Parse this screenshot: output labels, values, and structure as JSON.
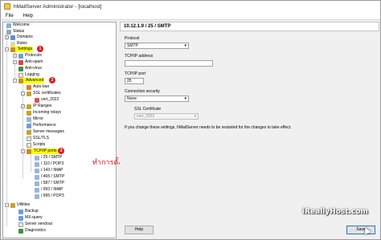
{
  "window": {
    "title": "hMailServer Administrator - [localhost]"
  },
  "menu": [
    "File",
    "Help"
  ],
  "tree": {
    "welcome": "Welcome",
    "status": "Status",
    "domains": "Domains",
    "rules": "Rules",
    "settings": "Settings",
    "protocols": "Protocols",
    "anti_spam": "Anti-spam",
    "anti_virus": "Anti-virus",
    "logging": "Logging",
    "advanced": "Advanced",
    "auto_ban": "Auto-ban",
    "ssl_certificates": "SSL certificates",
    "cert_2022": "cert_2022",
    "ip_ranges": "IP Ranges",
    "incoming_relays": "Incoming relays",
    "mirror": "Mirror",
    "performance": "Performance",
    "server_messages": "Server messages",
    "ssl_tls": "SSL/TLS",
    "scripts": "Scripts",
    "tcpip_ports": "TCP/IP ports",
    "ports": [
      "/ 25 / SMTP",
      "/ 110 / POP3",
      "/ 143 / IMAP",
      "/ 465 / SMTP",
      "/ 587 / SMTP",
      "/ 993 / IMAP",
      "/ 995 / POP3"
    ],
    "utilities": "Utilities",
    "backup": "Backup",
    "mx_query": "MX-query",
    "server_sendout": "Server sendout",
    "diagnostics": "Diagnostics",
    "badges": [
      "1",
      "2",
      "3"
    ]
  },
  "annotation": "ทำการตั้งค่าตามตารางคู่มือ",
  "panel": {
    "header": "10.12.1.9 / 25 / SMTP",
    "protocol_label": "Protocol",
    "protocol_value": "SMTP",
    "address_label": "TCP/IP address",
    "address_value": "",
    "port_label": "TCP/IP port",
    "port_value": "25",
    "security_label": "Connection security",
    "security_value": "None",
    "cert_label": "SSL Certificate",
    "cert_value": "cert_2022",
    "restart_note": "If you change these settings, hMailServer needs to be restarted for the changes to take effect.",
    "help_button": "Help",
    "save_button": "Save"
  },
  "watermark": "iReallyHost.com",
  "colors": {
    "highlight": "#ffff00",
    "badge": "#e01b1b",
    "annotation": "#d01818"
  }
}
